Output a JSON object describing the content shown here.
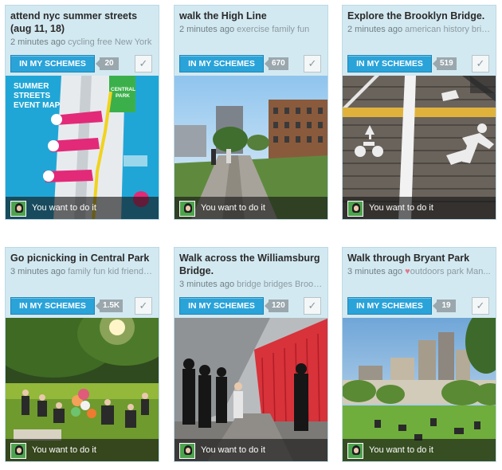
{
  "cards": [
    {
      "title": "attend nyc summer streets (aug 11, 18)",
      "time": "2 minutes ago",
      "tags": "cycling free New York",
      "heart": "",
      "scheme_label": "IN MY SCHEMES",
      "count": "20",
      "check_icon": "checkmark-icon",
      "footer_text": "You want to do it",
      "map_title": "SUMMER STREETS EVENT MAP",
      "map_park": "CENTRAL PARK"
    },
    {
      "title": "walk the High Line",
      "time": "2 minutes ago",
      "tags": "exercise family fun",
      "heart": "",
      "scheme_label": "IN MY SCHEMES",
      "count": "670",
      "check_icon": "checkmark-icon",
      "footer_text": "You want to do it"
    },
    {
      "title": "Explore the Brooklyn Bridge.",
      "time": "2 minutes ago",
      "tags": "american history bridge",
      "heart": "",
      "scheme_label": "IN MY SCHEMES",
      "count": "519",
      "check_icon": "checkmark-icon",
      "footer_text": "You want to do it"
    },
    {
      "title": "Go picnicking in Central Park",
      "time": "3 minutes ago",
      "tags": "family fun kid friendly N",
      "heart": "",
      "scheme_label": "IN MY SCHEMES",
      "count": "1.5K",
      "check_icon": "checkmark-icon",
      "footer_text": "You want to do it"
    },
    {
      "title": "Walk across the Williamsburg Bridge.",
      "time": "3 minutes ago",
      "tags": "bridge bridges Brook...",
      "heart": "",
      "scheme_label": "IN MY SCHEMES",
      "count": "120",
      "check_icon": "checkmark-icon",
      "footer_text": "You want to do it"
    },
    {
      "title": "Walk through Bryant Park",
      "time": "3 minutes ago",
      "tags": "outdoors park Man...",
      "heart": "♥",
      "scheme_label": "IN MY SCHEMES",
      "count": "19",
      "check_icon": "checkmark-icon",
      "footer_text": "You want to do it"
    }
  ],
  "colors": {
    "card_bg": "#d3e9f1",
    "scheme_button": "#2aa3d9",
    "count_badge": "#9aa7ad"
  }
}
